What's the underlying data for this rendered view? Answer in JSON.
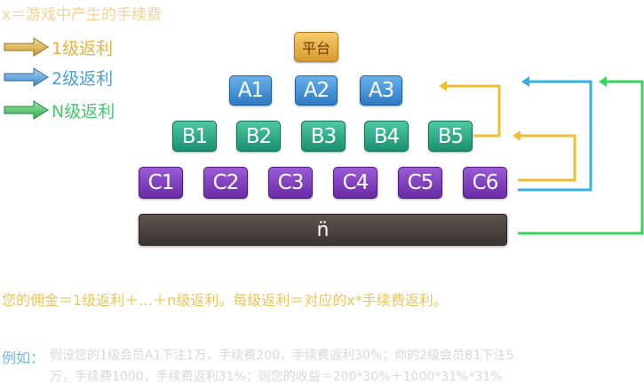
{
  "top_note": "x＝游戏中产生的手续费",
  "legend": [
    {
      "label": "1级返利",
      "color": "#e5b23d",
      "icon": "arrow-right-icon"
    },
    {
      "label": "2级返利",
      "color": "#4d9fd8",
      "icon": "arrow-right-icon"
    },
    {
      "label": "N级返利",
      "color": "#43c96a",
      "icon": "arrow-right-icon"
    }
  ],
  "platform": {
    "label": "平台"
  },
  "tiers": {
    "a": [
      "A1",
      "A2",
      "A3"
    ],
    "b": [
      "B1",
      "B2",
      "B3",
      "B4",
      "B5"
    ],
    "c": [
      "C1",
      "C2",
      "C3",
      "C4",
      "C5",
      "C6"
    ],
    "n": "n̈"
  },
  "colors": {
    "level1": "#f2bd32",
    "level2": "#33b1e6",
    "levelN": "#37d45c"
  },
  "formula": "您的佣金＝1级返利＋…＋n级返利。每级返利＝对应的x*手续费返利。",
  "example": {
    "label": "例如：",
    "line1": "假设您的1级会员A1下注1万，手续费200，手续费返利30%；你的2级会员B1下注5",
    "line2": "万，手续费1000，手续费返利31%；则您的收益＝200*30%＋1000*31%*31%"
  }
}
